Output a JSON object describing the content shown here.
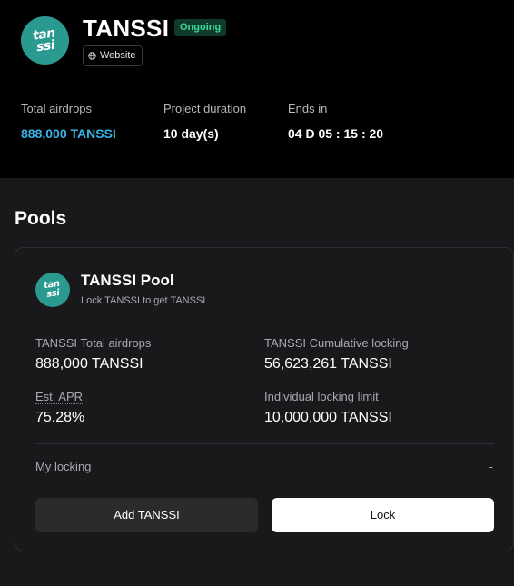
{
  "project": {
    "logo_text": "tan ssi",
    "title": "TANSSI",
    "status": "Ongoing",
    "website_label": "Website",
    "stats": [
      {
        "label": "Total airdrops",
        "value": "888,000 TANSSI"
      },
      {
        "label": "Project duration",
        "value": "10 day(s)"
      },
      {
        "label": "Ends in",
        "value": "04 D 05 : 15 : 20"
      }
    ]
  },
  "pools_title": "Pools",
  "pool": {
    "logo_text": "tan ssi",
    "name": "TANSSI Pool",
    "subtitle": "Lock TANSSI to get TANSSI",
    "total_airdrops_label": "TANSSI Total airdrops",
    "total_airdrops_value": "888,000 TANSSI",
    "cumulative_label": "TANSSI Cumulative locking",
    "cumulative_value": "56,623,261 TANSSI",
    "apr_label": "Est. APR",
    "apr_value": "75.28%",
    "limit_label": "Individual locking limit",
    "limit_value": "10,000,000 TANSSI",
    "my_locking_label": "My locking",
    "my_locking_value": "-",
    "add_button": "Add TANSSI",
    "lock_button": "Lock"
  },
  "colors": {
    "accent": "#3ab4e6",
    "status_green": "#3ddc97",
    "logo_teal": "#2a9a91"
  }
}
